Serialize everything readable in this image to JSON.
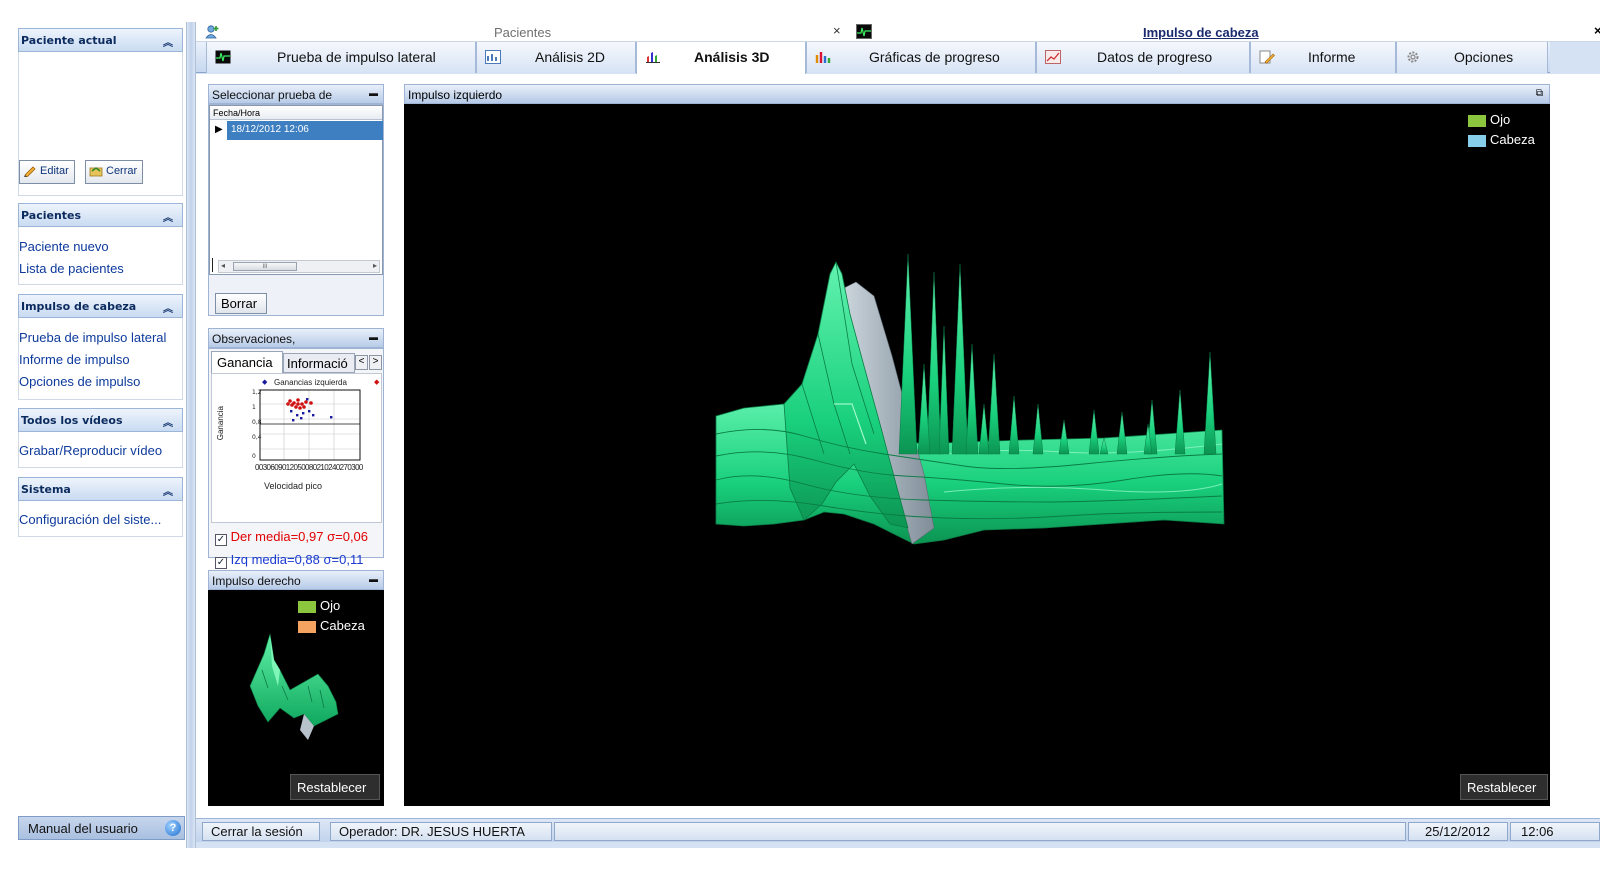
{
  "leftnav": {
    "current_patient": {
      "header": "Paciente actual",
      "edit_label": "Editar",
      "close_label": "Cerrar"
    },
    "patients": {
      "header": "Pacientes",
      "items": [
        "Paciente nuevo",
        "Lista de pacientes"
      ]
    },
    "head_impulse": {
      "header": "Impulso de cabeza",
      "items": [
        "Prueba de impulso lateral",
        "Informe de impulso",
        "Opciones de impulso"
      ]
    },
    "videos": {
      "header": "Todos los vídeos",
      "items": [
        "Grabar/Reproducir vídeo"
      ]
    },
    "system": {
      "header": "Sistema",
      "items": [
        "Configuración del siste..."
      ]
    },
    "footer": {
      "manual_label": "Manual del usuario",
      "help_glyph": "?"
    }
  },
  "document_tabs": {
    "left_title": "Pacientes",
    "right_title": "Impulso de cabeza",
    "close_glyph": "×"
  },
  "ribbon_tabs": [
    {
      "label": "Prueba de impulso lateral",
      "icon": "ecg-monitor-icon"
    },
    {
      "label": "Análisis 2D",
      "icon": "chart-2d-icon"
    },
    {
      "label": "Análisis 3D",
      "icon": "chart-3d-icon",
      "active": true
    },
    {
      "label": "Gráficas de progreso",
      "icon": "bar-chart-icon"
    },
    {
      "label": "Datos de progreso",
      "icon": "progress-data-icon"
    },
    {
      "label": "Informe",
      "icon": "report-pencil-icon"
    },
    {
      "label": "Opciones",
      "icon": "gear-icon"
    }
  ],
  "select_test": {
    "header": "Seleccionar prueba de",
    "column": "Fecha/Hora",
    "rows": [
      "18/12/2012 12:06"
    ],
    "delete_label": "Borrar",
    "scroll_thumb": "III"
  },
  "observations": {
    "header": "Observaciones,",
    "tabs": [
      "Ganancia",
      "Informació"
    ],
    "mini_chart": {
      "legend": "Ganancias izquierda",
      "ylabel": "Ganancia",
      "xlabel": "Velocidad pico",
      "x_ticks": "0030609012050080210240270300"
    },
    "right_stats": "Der media=0,97 σ=0,06",
    "left_stats": "Izq media=0,88 σ=0,11",
    "right_checked": true,
    "left_checked": true
  },
  "right_impulse": {
    "header": "Impulso derecho",
    "legend": [
      {
        "name": "Ojo",
        "color": "#8cc63f"
      },
      {
        "name": "Cabeza",
        "color": "#f4a460"
      }
    ],
    "reset_label": "Restablecer"
  },
  "left_impulse": {
    "header": "Impulso izquierdo",
    "legend": [
      {
        "name": "Ojo",
        "color": "#8cc63f"
      },
      {
        "name": "Cabeza",
        "color": "#87ceeb"
      }
    ],
    "reset_label": "Restablecer"
  },
  "statusbar": {
    "logout_label": "Cerrar la sesión",
    "operator": "Operador: DR. JESUS HUERTA",
    "date": "25/12/2012",
    "time": "12:06"
  },
  "colors": {
    "surface_green": "#19e083",
    "surface_gray": "#9aa8b4",
    "header_blue": "#c9dbf2"
  }
}
